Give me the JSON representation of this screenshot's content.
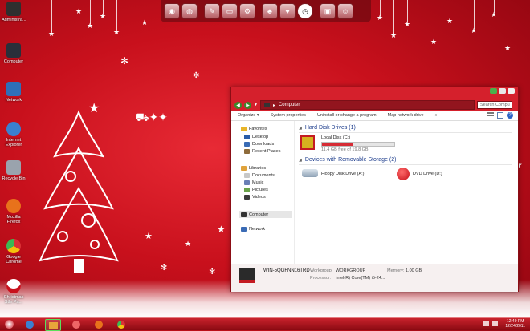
{
  "desktop": {
    "icons": [
      {
        "label": "Administra...",
        "icon": "user-folder-icon",
        "color": "#2f2f2f"
      },
      {
        "label": "Computer",
        "icon": "computer-icon",
        "color": "#2a2f3a"
      },
      {
        "label": "Network",
        "icon": "network-icon",
        "color": "#2f6fb8"
      },
      {
        "label": "Internet Explorer",
        "icon": "internet-explorer-icon",
        "color": "#3b80d0"
      },
      {
        "label": "Recycle Bin",
        "icon": "recycle-bin-icon",
        "color": "#9aa3ad"
      },
      {
        "label": "Mozilla Firefox",
        "icon": "firefox-icon",
        "color": "#e8721b"
      },
      {
        "label": "Google Chrome",
        "icon": "chrome-icon",
        "color": "#4b9e3c"
      },
      {
        "label": "Christmas Stle Pa...",
        "icon": "santa-icon",
        "color": "#ffffff"
      }
    ]
  },
  "dock": {
    "items": [
      "start-orb-icon",
      "globe-icon",
      "tools-icon",
      "document-icon",
      "settings-icon",
      "tree-icon",
      "heart-icon",
      "clock-icon",
      "lock-icon",
      "user-icon"
    ]
  },
  "window": {
    "address": "Computer",
    "search_placeholder": "Search Compu",
    "toolbar": {
      "organize": "Organize ▾",
      "system_properties": "System properties",
      "uninstall": "Uninstall or change a program",
      "map_drive": "Map network drive",
      "more": "»"
    },
    "nav": {
      "favorites": "Favorites",
      "desktop": "Desktop",
      "downloads": "Downloads",
      "recent": "Recent Places",
      "libraries": "Libraries",
      "documents": "Documents",
      "music": "Music",
      "pictures": "Pictures",
      "videos": "Videos",
      "computer": "Computer",
      "network": "Network"
    },
    "hard_disk_header": "Hard Disk Drives (1)",
    "local_disk": {
      "name": "Local Disk (C:)",
      "free": "11.4 GB free of 19.8 GB",
      "used_fraction": 0.42
    },
    "removable_header": "Devices with Removable Storage (2)",
    "floppy": "Floppy Disk Drive (A:)",
    "dvd": "DVD Drive (D:)",
    "details": {
      "computer_name": "WIN-5QGFNN16TRD",
      "workgroup_label": "Workgroup:",
      "workgroup": "WORKGROUP",
      "memory_label": "Memory:",
      "memory": "1.00 GB",
      "processor_label": "Processor:",
      "processor": "Intel(R) Core(TM) i5-24..."
    }
  },
  "taskbar": {
    "time": "12:49 PM",
    "date": "12/24/2011"
  },
  "colors": {
    "accent": "#d5202c",
    "link": "#1c3c8c"
  }
}
